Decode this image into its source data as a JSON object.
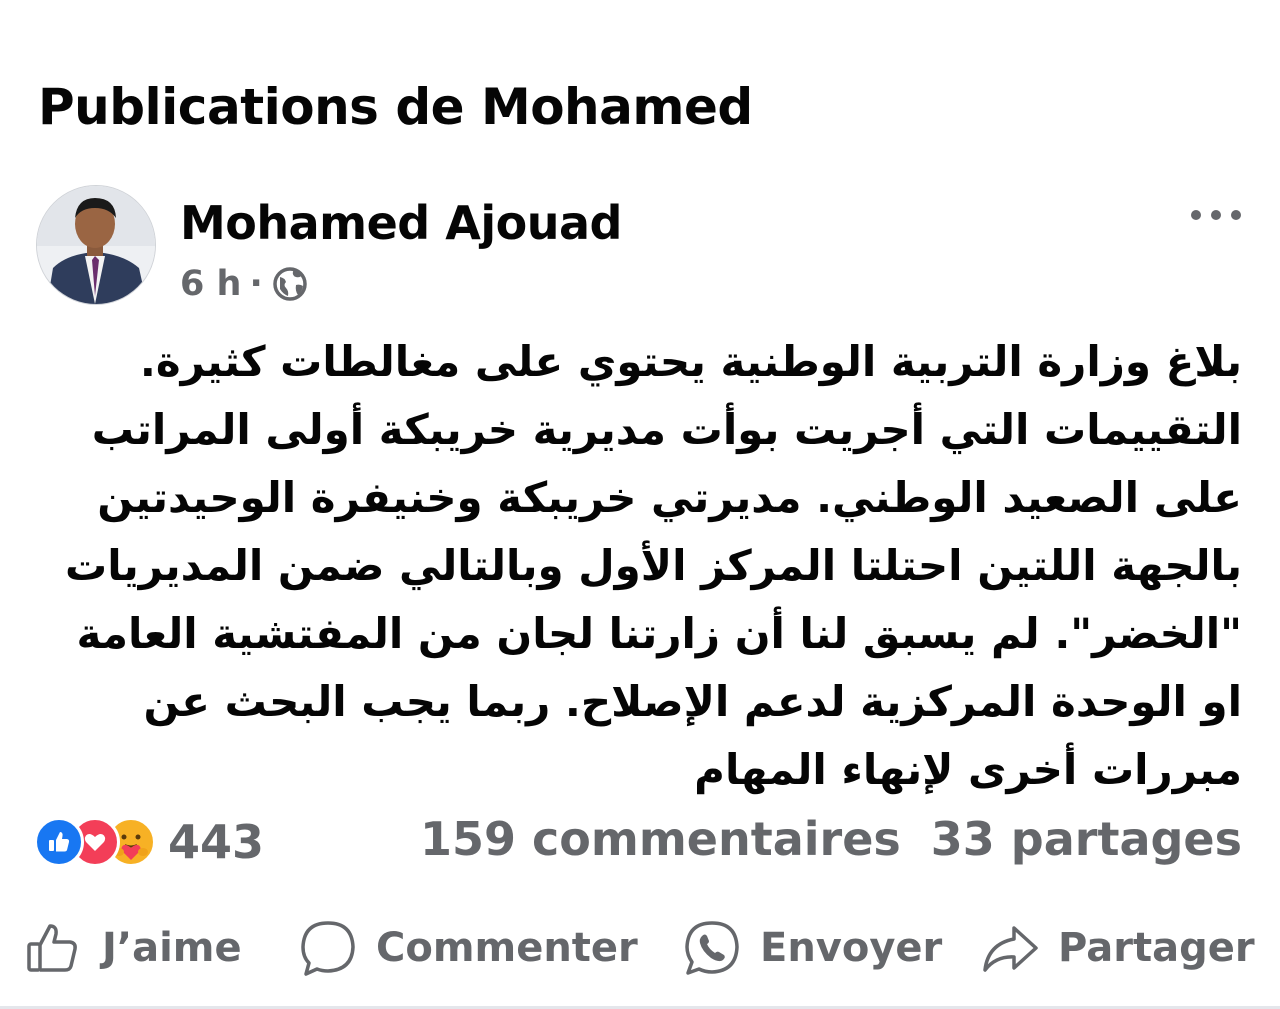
{
  "section": {
    "title": "Publications de Mohamed"
  },
  "post": {
    "author": "Mohamed Ajouad",
    "time": "6 h",
    "separator": "·",
    "privacy_icon": "globe-icon",
    "more_icon": "more-options-icon",
    "body_lines": [
      "بلاغ وزارة التربية الوطنية يحتوي على مغالطات كثيرة.",
      "التقييمات التي أجريت بوأت مديرية خريبكة أولى المراتب",
      "على الصعيد الوطني. مديرتي خريبكة وخنيفرة الوحيدتين",
      "بالجهة اللتين احتلتا المركز الأول وبالتالي ضمن المديريات",
      "\"الخضر\". لم يسبق لنا أن زارتنا لجان من المفتشية العامة",
      "او الوحدة المركزية لدعم الإصلاح. ربما يجب البحث عن",
      "مبررات أخرى لإنهاء المهام"
    ]
  },
  "stats": {
    "reaction_icons": [
      "like-reaction-icon",
      "love-reaction-icon",
      "care-reaction-icon"
    ],
    "reaction_count": "443",
    "comments": "159 commentaires",
    "shares": "33 partages"
  },
  "actions": {
    "like": "J’aime",
    "comment": "Commenter",
    "send": "Envoyer",
    "share": "Partager"
  },
  "colors": {
    "text_primary": "#050505",
    "text_secondary": "#65676b",
    "like_blue": "#1877f2",
    "love_red": "#f33e58",
    "care_yellow": "#f7b125",
    "divider": "#e4e6eb"
  }
}
